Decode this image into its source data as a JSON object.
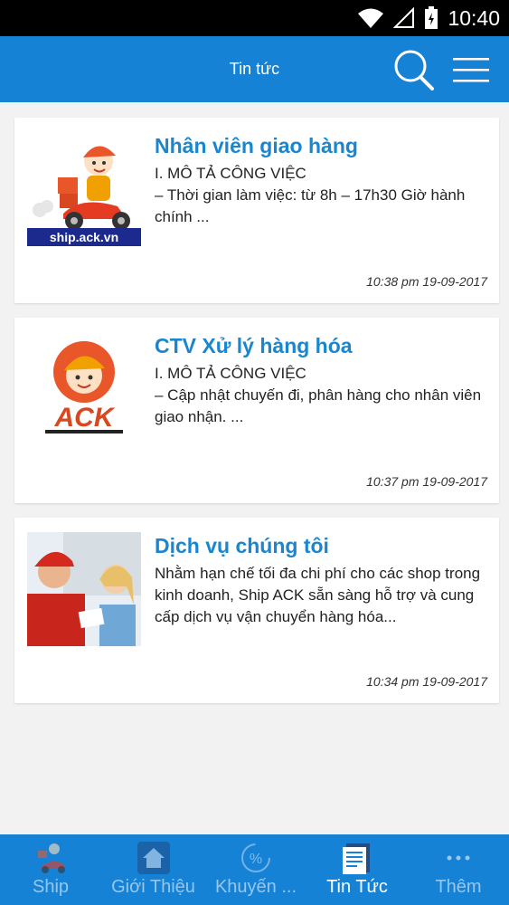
{
  "status_bar": {
    "time": "10:40"
  },
  "app_bar": {
    "title": "Tin tức"
  },
  "articles": [
    {
      "title": "Nhân viên giao hàng",
      "excerpt": "I. MÔ TẢ CÔNG VIỆC\n– Thời gian làm việc: từ 8h – 17h30 Giờ hành chính ...",
      "date": "10:38 pm 19-09-2017",
      "thumb_caption": "ship.ack.vn"
    },
    {
      "title": "CTV Xử lý hàng hóa",
      "excerpt": "I. MÔ TẢ CÔNG VIỆC\n– Cập nhật chuyến đi, phân hàng cho nhân viên giao nhận. ...",
      "date": "10:37 pm 19-09-2017",
      "thumb_caption": "ACK"
    },
    {
      "title": "Dịch vụ chúng tôi",
      "excerpt": "Nhằm hạn chế tối đa chi phí cho các shop trong kinh doanh, Ship ACK sẵn sàng hỗ trợ và cung cấp dịch vụ vận chuyển hàng hóa...",
      "date": "10:34 pm 19-09-2017"
    }
  ],
  "bottom_nav": [
    {
      "label": "Ship",
      "icon": "ship-scooter-icon"
    },
    {
      "label": "Giới Thiệu",
      "icon": "home-icon"
    },
    {
      "label": "Khuyến ...",
      "icon": "percent-icon"
    },
    {
      "label": "Tin Tức",
      "icon": "newspaper-icon",
      "active": true
    },
    {
      "label": "Thêm",
      "icon": "more-dots-icon"
    }
  ],
  "colors": {
    "primary": "#1582d6",
    "title": "#1a86cf",
    "background": "#f2f2f2"
  }
}
